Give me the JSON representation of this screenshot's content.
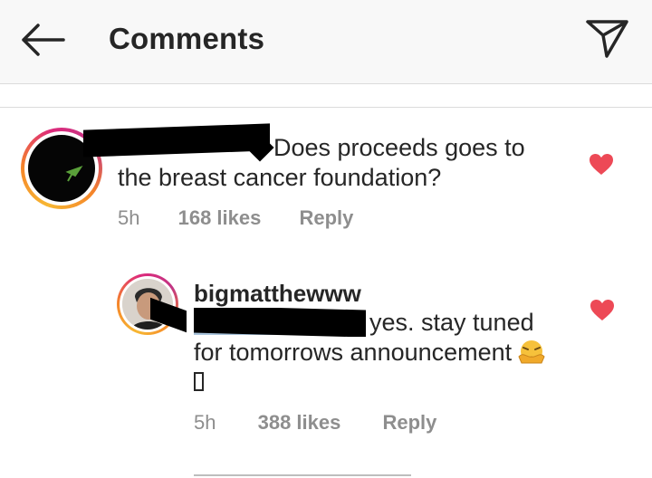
{
  "header": {
    "title": "Comments",
    "back_icon": "arrow-left-icon",
    "send_icon": "paper-plane-icon"
  },
  "comments": [
    {
      "text": "Does proceeds goes to the breast cancer foundation?",
      "line1": "Does proceeds goes to",
      "line2": "the breast cancer foundation?",
      "time": "5h",
      "likes": "168 likes",
      "reply": "Reply"
    },
    {
      "username": "bigmatthewww",
      "line1": "yes. stay tuned",
      "line2": "for tomorrows announcement",
      "line3": "",
      "time": "5h",
      "likes": "388 likes",
      "reply": "Reply"
    }
  ],
  "colors": {
    "heart": "#ed4956",
    "meta": "#8e8e8e",
    "mention": "#003569"
  }
}
